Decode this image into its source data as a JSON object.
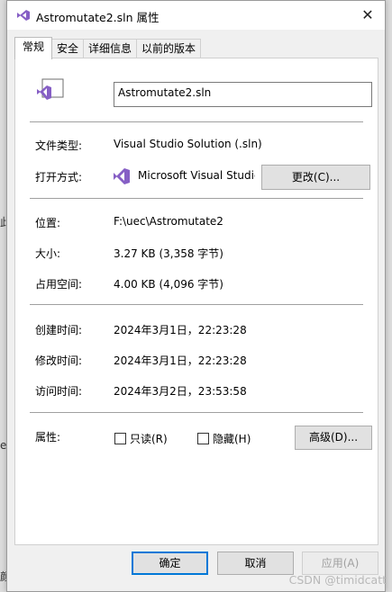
{
  "window": {
    "title": "Astromutate2.sln 属性",
    "close_glyph": "✕"
  },
  "tabs": [
    {
      "label": "常规",
      "active": true
    },
    {
      "label": "安全"
    },
    {
      "label": "详细信息"
    },
    {
      "label": "以前的版本"
    }
  ],
  "general": {
    "file_name": "Astromutate2.sln",
    "type_label": "文件类型:",
    "type_value": "Visual Studio Solution (.sln)",
    "open_with_label": "打开方式:",
    "open_with_value": "Microsoft Visual Studio",
    "change_button": "更改(C)...",
    "location_label": "位置:",
    "location_value": "F:\\uec\\Astromutate2",
    "size_label": "大小:",
    "size_value": "3.27 KB (3,358 字节)",
    "disk_size_label": "占用空间:",
    "disk_size_value": "4.00 KB (4,096 字节)",
    "created_label": "创建时间:",
    "created_value": "2024年3月1日，22:23:28",
    "modified_label": "修改时间:",
    "modified_value": "2024年3月1日，22:23:28",
    "accessed_label": "访问时间:",
    "accessed_value": "2024年3月2日，23:53:58",
    "attributes_label": "属性:",
    "readonly_label": "只读(R)",
    "hidden_label": "隐藏(H)",
    "advanced_button": "高级(D)..."
  },
  "footer": {
    "ok": "确定",
    "cancel": "取消",
    "apply": "应用(A)"
  },
  "background": {
    "left_glyphs": [
      "此",
      "e",
      "颜"
    ],
    "watermark": "CSDN @timidcatt"
  },
  "colors": {
    "vs_purple": "#865fc5",
    "accent": "#0078d7"
  },
  "icons": {
    "title": "visual-studio-icon",
    "file": "sln-file-icon",
    "app": "visual-studio-icon"
  }
}
